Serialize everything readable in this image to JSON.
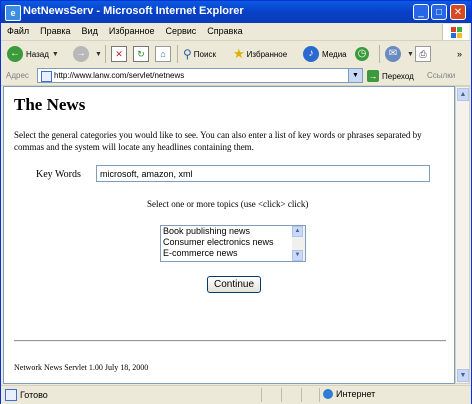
{
  "window": {
    "title": "NetNewsServ - Microsoft Internet Explorer"
  },
  "menu": [
    "Файл",
    "Правка",
    "Вид",
    "Избранное",
    "Сервис",
    "Справка"
  ],
  "toolbar": {
    "back": "Назад",
    "search": "Поиск",
    "favorites": "Избранное",
    "media": "Медиа"
  },
  "address": {
    "label": "Адрес",
    "url": "http://www.lanw.com/servlet/netnews",
    "go": "Переход",
    "links": "Ссылки"
  },
  "page": {
    "heading": "The News",
    "intro": "Select the general categories you would like to see. You can also enter a list of key words or phrases separated by commas and the system will locate any headlines containing them.",
    "keywords_label": "Key Words",
    "keywords_value": "microsoft, amazon, xml",
    "select_hint": "Select one or more topics (use <click> click)",
    "topics": [
      "Book publishing news",
      "Consumer electronics news",
      "E-commerce news"
    ],
    "continue": "Continue",
    "footer": "Network News Servlet 1.00 July 18, 2000"
  },
  "status": {
    "text": "Готово",
    "zone": "Интернет"
  }
}
